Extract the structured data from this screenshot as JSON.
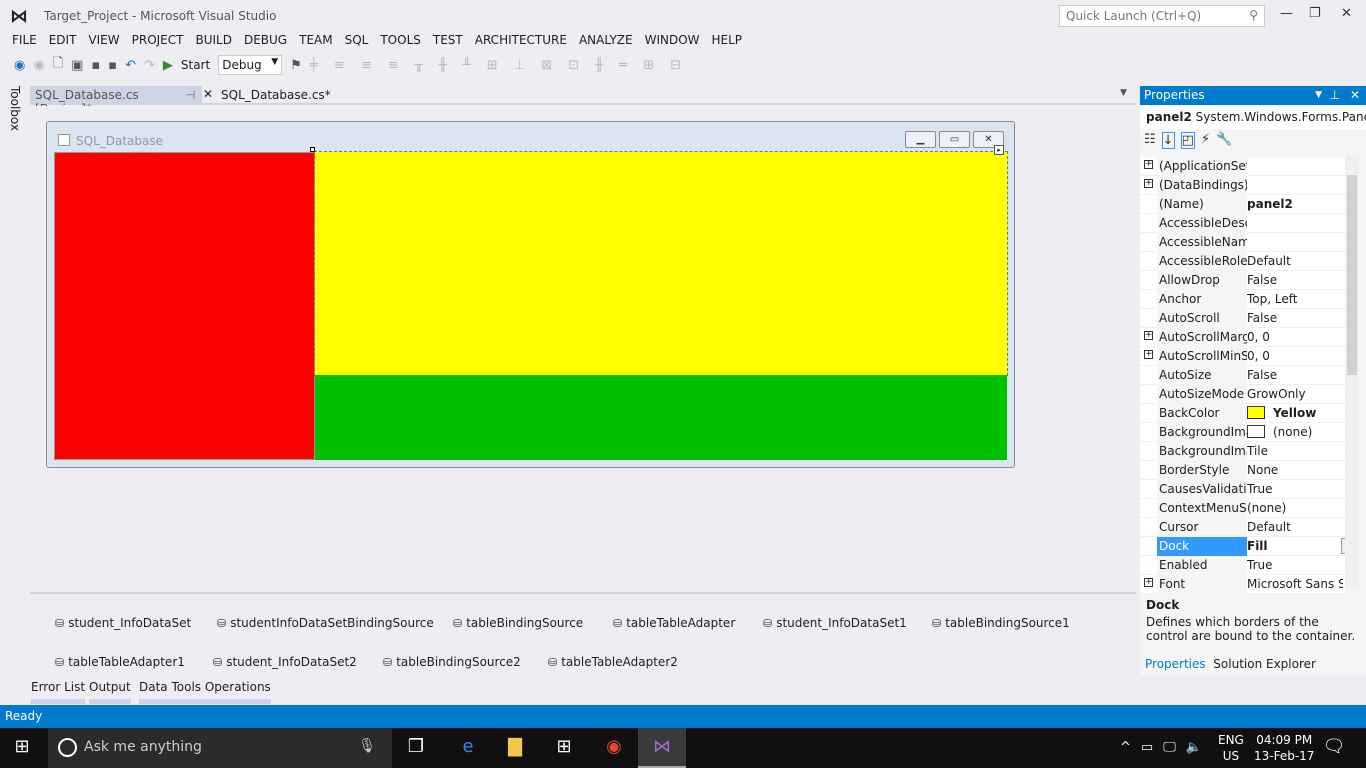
{
  "window": {
    "title": "Target_Project - Microsoft Visual Studio",
    "quick_launch": "Quick Launch (Ctrl+Q)"
  },
  "menu": [
    "FILE",
    "EDIT",
    "VIEW",
    "PROJECT",
    "BUILD",
    "DEBUG",
    "TEAM",
    "SQL",
    "TOOLS",
    "TEST",
    "ARCHITECTURE",
    "ANALYZE",
    "WINDOW",
    "HELP"
  ],
  "toolbar": {
    "start_label": "Start",
    "config": "Debug"
  },
  "toolbox_label": "Toolbox",
  "tabs": [
    {
      "label": "SQL_Database.cs [Design]*"
    },
    {
      "label": "SQL_Database.cs*"
    }
  ],
  "form": {
    "title": "SQL_Database",
    "colors": {
      "panel1": "#ff0000",
      "panel2": "#ffff00",
      "panel3": "#00c000"
    }
  },
  "tray": [
    "student_InfoDataSet",
    "studentInfoDataSetBindingSource",
    "tableBindingSource",
    "tableTableAdapter",
    "student_InfoDataSet1",
    "tableBindingSource1",
    "tableTableAdapter1",
    "student_InfoDataSet2",
    "tableBindingSource2",
    "tableTableAdapter2"
  ],
  "bottom_tabs": [
    "Error List",
    "Output",
    "Data Tools Operations"
  ],
  "status": "Ready",
  "properties": {
    "title": "Properties",
    "object_name": "panel2",
    "object_type": "System.Windows.Forms.Pane",
    "rows": [
      {
        "name": "(ApplicationSett",
        "value": "",
        "expand": true
      },
      {
        "name": "(DataBindings)",
        "value": "",
        "expand": true
      },
      {
        "name": "(Name)",
        "value": "panel2",
        "bold": true
      },
      {
        "name": "AccessibleDescr",
        "value": ""
      },
      {
        "name": "AccessibleName",
        "value": ""
      },
      {
        "name": "AccessibleRole",
        "value": "Default"
      },
      {
        "name": "AllowDrop",
        "value": "False"
      },
      {
        "name": "Anchor",
        "value": "Top, Left"
      },
      {
        "name": "AutoScroll",
        "value": "False"
      },
      {
        "name": "AutoScrollMargi",
        "value": "0, 0",
        "expand": true
      },
      {
        "name": "AutoScrollMinSi",
        "value": "0, 0",
        "expand": true
      },
      {
        "name": "AutoSize",
        "value": "False"
      },
      {
        "name": "AutoSizeMode",
        "value": "GrowOnly"
      },
      {
        "name": "BackColor",
        "value": "Yellow",
        "bold": true,
        "swatch": "#ffff00"
      },
      {
        "name": "BackgroundIma",
        "value": "(none)",
        "swatch": "#ffffff"
      },
      {
        "name": "BackgroundIma",
        "value": "Tile"
      },
      {
        "name": "BorderStyle",
        "value": "None"
      },
      {
        "name": "CausesValidatior",
        "value": "True"
      },
      {
        "name": "ContextMenuStr",
        "value": "(none)"
      },
      {
        "name": "Cursor",
        "value": "Default"
      },
      {
        "name": "Dock",
        "value": "Fill",
        "bold": true,
        "selected": true
      },
      {
        "name": "Enabled",
        "value": "True"
      },
      {
        "name": "Font",
        "value": "Microsoft Sans Se",
        "expand": true
      }
    ],
    "desc_title": "Dock",
    "desc_text": "Defines which borders of the control are bound to the container.",
    "bottom_tabs": [
      "Properties",
      "Solution Explorer"
    ]
  },
  "taskbar": {
    "search_placeholder": "Ask me anything",
    "lang1": "ENG",
    "lang2": "US",
    "time": "04:09 PM",
    "date": "13-Feb-17"
  }
}
